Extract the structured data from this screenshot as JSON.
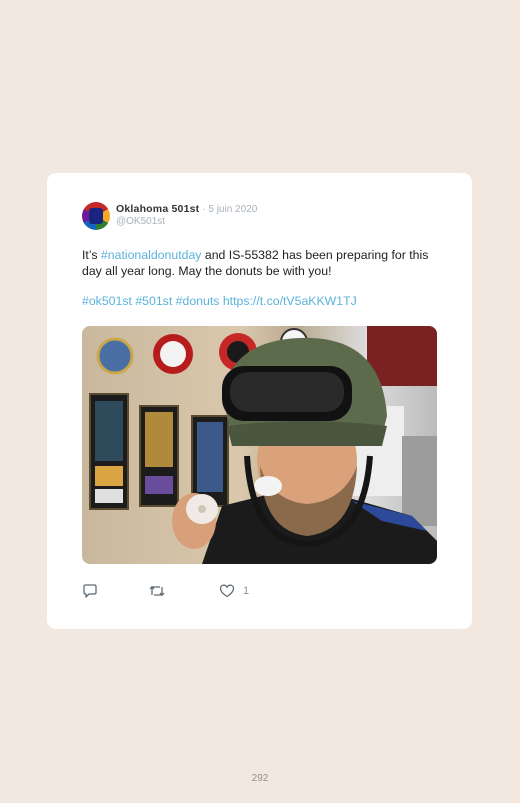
{
  "tweet": {
    "author_name": "Oklahoma 501st",
    "date": "· 5 juin 2020",
    "handle": "@OK501st",
    "text_before": "It’s ",
    "hashtag_national": "#nationaldonutday",
    "text_after": " and IS-55382 has been preparing for this day all year long. May the donuts be with you!",
    "tags": "#ok501st #501st #donuts https://t.co/tV5aKKW1TJ",
    "like_count": "1"
  },
  "page_number": "292",
  "icons": [
    "reply-icon",
    "retweet-icon",
    "heart-icon"
  ],
  "colors": {
    "background": "#f2e8df",
    "card": "#ffffff",
    "link": "#5ab2dc",
    "muted": "#a9b2bb"
  }
}
